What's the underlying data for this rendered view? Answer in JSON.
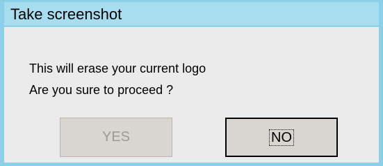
{
  "window": {
    "title": "Take screenshot"
  },
  "message": {
    "line1": "This will erase your current logo",
    "line2": "Are you sure to proceed ?"
  },
  "buttons": {
    "yes_label": "YES",
    "no_label": "NO"
  },
  "colors": {
    "titlebar": "#a8dcef",
    "frame": "#8ccfe8",
    "dialog_bg": "#ebebeb",
    "button_bg": "#d9d5d0"
  }
}
